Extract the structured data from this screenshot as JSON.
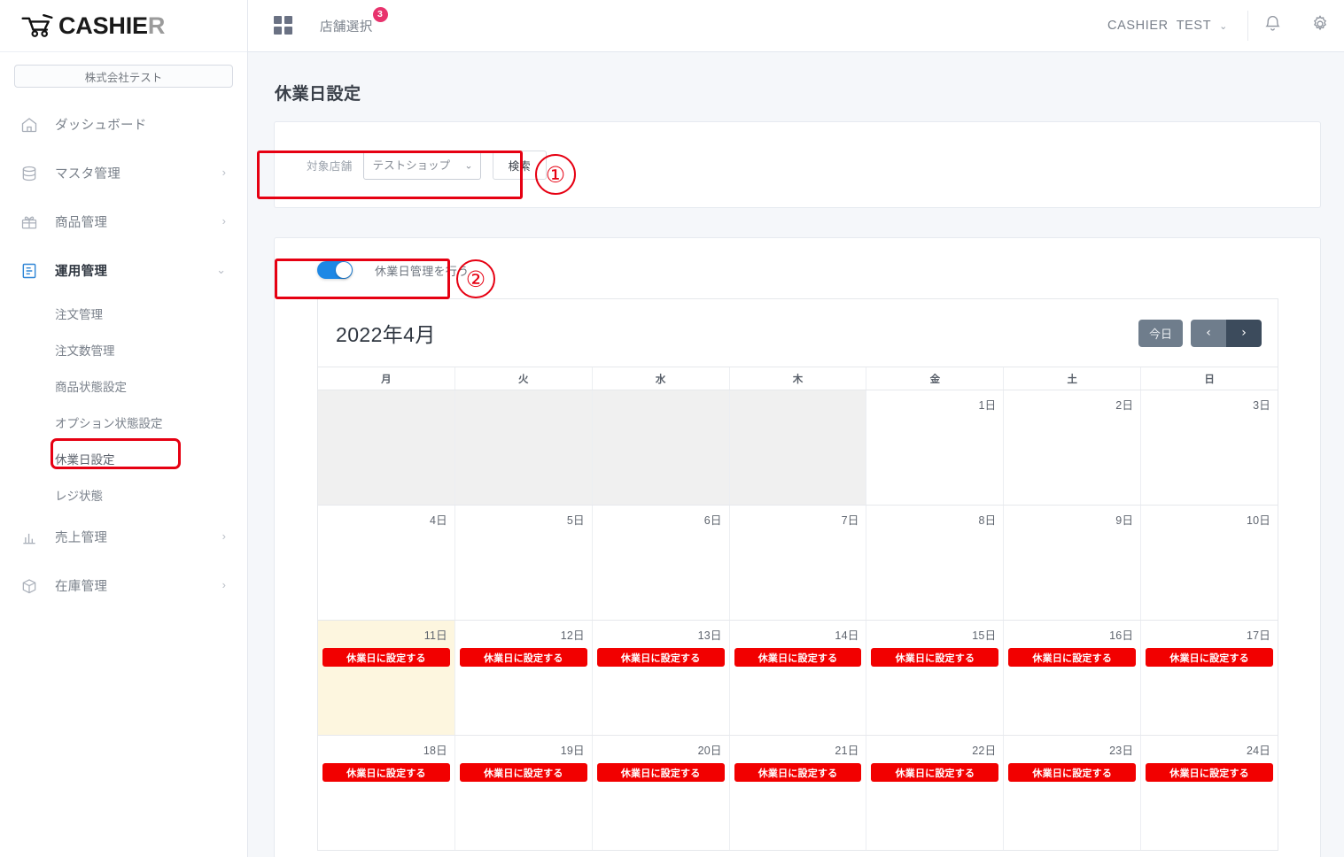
{
  "brand": {
    "name_main": "CASHIE",
    "name_accent": "R",
    "icon": "shopping-cart-icon"
  },
  "sidebar": {
    "company": "株式会社テスト",
    "items": [
      {
        "label": "ダッシュボード",
        "icon": "home-icon",
        "expandable": false
      },
      {
        "label": "マスタ管理",
        "icon": "database-icon",
        "expandable": true,
        "chevron": "›"
      },
      {
        "label": "商品管理",
        "icon": "gift-icon",
        "expandable": true,
        "chevron": "›"
      },
      {
        "label": "運用管理",
        "icon": "clipboard-icon",
        "expandable": true,
        "chevron": "⌄",
        "active": true
      },
      {
        "label": "売上管理",
        "icon": "bar-chart-icon",
        "expandable": true,
        "chevron": "›"
      },
      {
        "label": "在庫管理",
        "icon": "box-icon",
        "expandable": true,
        "chevron": "›"
      }
    ],
    "sub_items": [
      {
        "label": "注文管理"
      },
      {
        "label": "注文数管理"
      },
      {
        "label": "商品状態設定"
      },
      {
        "label": "オプション状態設定"
      },
      {
        "label": "休業日設定",
        "highlighted": true
      },
      {
        "label": "レジ状態"
      }
    ]
  },
  "topbar": {
    "grid_icon": "grid-icon",
    "store_select_label": "店舗選択",
    "store_select_badge": "3",
    "user_org": "CASHIER",
    "user_name": "TEST",
    "user_caret": "⌄",
    "bell_icon": "bell-icon",
    "gear_icon": "gear-icon"
  },
  "main": {
    "page_title": "休業日設定",
    "search": {
      "field_label": "対象店舗",
      "selected_store": "テストショップ",
      "options": [
        "テストショップ"
      ],
      "search_button": "検索"
    },
    "toggle": {
      "label": "休業日管理を行う",
      "on": true
    },
    "annotations": [
      {
        "number": "①",
        "target": "search-filter-row"
      },
      {
        "number": "②",
        "target": "holiday-management-toggle"
      }
    ]
  },
  "calendar": {
    "month_title": "2022年4月",
    "today_button": "今日",
    "prev_button": "‹",
    "next_button": "›",
    "day_headers": [
      "月",
      "火",
      "水",
      "木",
      "金",
      "土",
      "日"
    ],
    "holiday_button_label": "休業日に設定する",
    "weeks": [
      [
        {
          "label": "",
          "type": "blank"
        },
        {
          "label": "",
          "type": "blank"
        },
        {
          "label": "",
          "type": "blank"
        },
        {
          "label": "",
          "type": "blank"
        },
        {
          "label": "1日",
          "type": "past"
        },
        {
          "label": "2日",
          "type": "past"
        },
        {
          "label": "3日",
          "type": "past"
        }
      ],
      [
        {
          "label": "4日",
          "type": "past"
        },
        {
          "label": "5日",
          "type": "past"
        },
        {
          "label": "6日",
          "type": "past"
        },
        {
          "label": "7日",
          "type": "past"
        },
        {
          "label": "8日",
          "type": "past"
        },
        {
          "label": "9日",
          "type": "past"
        },
        {
          "label": "10日",
          "type": "past"
        }
      ],
      [
        {
          "label": "11日",
          "type": "today",
          "action": true
        },
        {
          "label": "12日",
          "type": "future",
          "action": true
        },
        {
          "label": "13日",
          "type": "future",
          "action": true
        },
        {
          "label": "14日",
          "type": "future",
          "action": true
        },
        {
          "label": "15日",
          "type": "future",
          "action": true
        },
        {
          "label": "16日",
          "type": "future",
          "action": true
        },
        {
          "label": "17日",
          "type": "future",
          "action": true
        }
      ],
      [
        {
          "label": "18日",
          "type": "future",
          "action": true
        },
        {
          "label": "19日",
          "type": "future",
          "action": true
        },
        {
          "label": "20日",
          "type": "future",
          "action": true
        },
        {
          "label": "21日",
          "type": "future",
          "action": true
        },
        {
          "label": "22日",
          "type": "future",
          "action": true
        },
        {
          "label": "23日",
          "type": "future",
          "action": true
        },
        {
          "label": "24日",
          "type": "future",
          "action": true
        }
      ]
    ]
  },
  "colors": {
    "accent_red": "#e60012",
    "holiday_button": "#f20000",
    "toggle_on": "#1e88e5",
    "badge_pink": "#e8336d",
    "today_cell": "#fdf6df",
    "page_bg": "#f5f7fa"
  }
}
